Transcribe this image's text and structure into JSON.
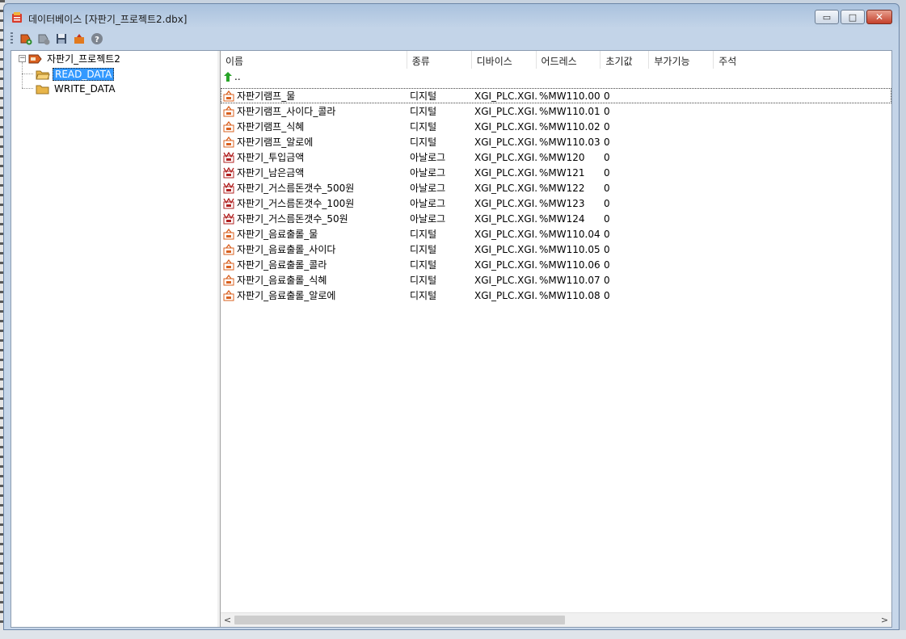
{
  "window": {
    "title": "데이터베이스 [자판기_프로젝트2.dbx]",
    "minimize_glyph": "▭",
    "maximize_glyph": "□",
    "close_glyph": "✕"
  },
  "toolbar": {
    "buttons": [
      {
        "icon": "add-item-icon"
      },
      {
        "icon": "edit-item-icon"
      },
      {
        "icon": "save-icon"
      },
      {
        "icon": "export-icon"
      },
      {
        "icon": "help-icon"
      }
    ]
  },
  "tree": {
    "root": {
      "label": "자판기_프로젝트2",
      "expander": "−"
    },
    "children": [
      {
        "label": "READ_DATA",
        "selected": true
      },
      {
        "label": "WRITE_DATA",
        "selected": false
      }
    ]
  },
  "list": {
    "columns": [
      "이름",
      "종류",
      "디바이스",
      "어드레스",
      "초기값",
      "부가기능",
      "주석"
    ],
    "up_label": "..",
    "rows": [
      {
        "name": "자판기램프_물",
        "type": "디지털",
        "device": "XGI_PLC.XGI...",
        "address": "%MW110.00",
        "init": "0",
        "kind": "digital"
      },
      {
        "name": "자판기램프_사이다_콜라",
        "type": "디지털",
        "device": "XGI_PLC.XGI...",
        "address": "%MW110.01",
        "init": "0",
        "kind": "digital"
      },
      {
        "name": "자판기램프_식혜",
        "type": "디지털",
        "device": "XGI_PLC.XGI...",
        "address": "%MW110.02",
        "init": "0",
        "kind": "digital"
      },
      {
        "name": "자판기램프_알로에",
        "type": "디지털",
        "device": "XGI_PLC.XGI...",
        "address": "%MW110.03",
        "init": "0",
        "kind": "digital"
      },
      {
        "name": "자판기_투입금액",
        "type": "아날로그",
        "device": "XGI_PLC.XGI...",
        "address": "%MW120",
        "init": "0",
        "kind": "analog"
      },
      {
        "name": "자판기_남은금액",
        "type": "아날로그",
        "device": "XGI_PLC.XGI...",
        "address": "%MW121",
        "init": "0",
        "kind": "analog"
      },
      {
        "name": "자판기_거스름돈갯수_500원",
        "type": "아날로그",
        "device": "XGI_PLC.XGI...",
        "address": "%MW122",
        "init": "0",
        "kind": "analog"
      },
      {
        "name": "자판기_거스름돈갯수_100원",
        "type": "아날로그",
        "device": "XGI_PLC.XGI...",
        "address": "%MW123",
        "init": "0",
        "kind": "analog"
      },
      {
        "name": "자판기_거스름돈갯수_50원",
        "type": "아날로그",
        "device": "XGI_PLC.XGI...",
        "address": "%MW124",
        "init": "0",
        "kind": "analog"
      },
      {
        "name": "자판기_음료출롤_물",
        "type": "디지털",
        "device": "XGI_PLC.XGI...",
        "address": "%MW110.04",
        "init": "0",
        "kind": "digital"
      },
      {
        "name": "자판기_음료출롤_사이다",
        "type": "디지털",
        "device": "XGI_PLC.XGI...",
        "address": "%MW110.05",
        "init": "0",
        "kind": "digital"
      },
      {
        "name": "자판기_음료출롤_콜라",
        "type": "디지털",
        "device": "XGI_PLC.XGI...",
        "address": "%MW110.06",
        "init": "0",
        "kind": "digital"
      },
      {
        "name": "자판기_음료출롤_식혜",
        "type": "디지털",
        "device": "XGI_PLC.XGI...",
        "address": "%MW110.07",
        "init": "0",
        "kind": "digital"
      },
      {
        "name": "자판기_음료출롤_알로에",
        "type": "디지털",
        "device": "XGI_PLC.XGI...",
        "address": "%MW110.08",
        "init": "0",
        "kind": "digital"
      }
    ]
  },
  "scrollbar": {
    "left_arrow": "<",
    "right_arrow": ">"
  },
  "colors": {
    "selection": "#3399ff",
    "digital_icon": "#d9601f",
    "analog_icon": "#b02020"
  }
}
